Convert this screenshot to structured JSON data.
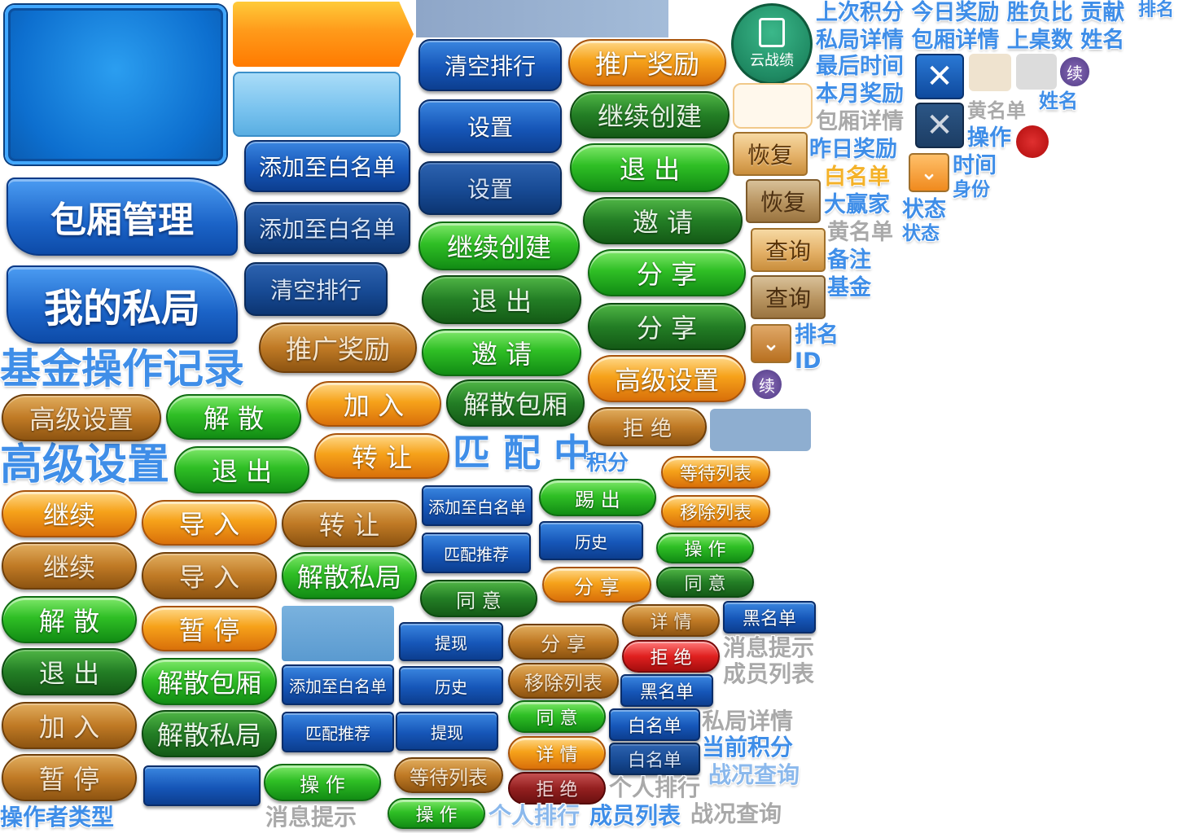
{
  "banners": {
    "room_manage": "包厢管理",
    "my_private": "我的私局"
  },
  "titles": {
    "fund_log": "基金操作记录",
    "advanced": "高级设置",
    "matching": "匹 配 中",
    "operator_type": "操作者类型"
  },
  "blue_buttons": {
    "clear_rank_1": "清空排行",
    "settings_1": "设置",
    "settings_2": "设置",
    "whitelist_add_1": "添加至白名单",
    "whitelist_add_2": "添加至白名单",
    "clear_rank_2": "清空排行",
    "whitelist_add_3": "添加至白名单",
    "match_rec_1": "匹配推荐",
    "history_1": "历史",
    "withdraw_1": "提现",
    "whitelist_add_4": "添加至白名单",
    "history_2": "历史",
    "match_rec_2": "匹配推荐",
    "withdraw_2": "提现",
    "blacklist_1": "黑名单",
    "blacklist_2": "黑名单",
    "whitelist_1": "白名单",
    "whitelist_2": "白名单"
  },
  "orange_buttons": {
    "promo_reward_1": "推广奖励",
    "promo_reward_2": "推广奖励",
    "advanced_1": "高级设置",
    "advanced_2": "高级设置",
    "join_1": "加 入",
    "transfer_1": "转 让",
    "continue_1": "继续",
    "continue_2": "继续",
    "import_1": "导 入",
    "import_2": "导 入",
    "transfer_2": "转 让",
    "pause_1": "暂 停",
    "join_2": "加 入",
    "pause_2": "暂 停",
    "reject_1": "拒 绝",
    "wait_list_1": "等待列表",
    "remove_list_1": "移除列表",
    "share_1": "分 享",
    "detail_1": "详 情",
    "share_2": "分 享",
    "remove_list_2": "移除列表",
    "detail_2": "详 情",
    "wait_list_2": "等待列表"
  },
  "green_buttons": {
    "continue_create_1": "继续创建",
    "continue_create_2": "继续创建",
    "exit_1": "退 出",
    "exit_2": "退 出",
    "invite_1": "邀 请",
    "invite_2": "邀 请",
    "share_1": "分 享",
    "share_2": "分 享",
    "dissolve_1": "解 散",
    "exit_3": "退 出",
    "dissolve_room_1": "解散包厢",
    "dissolve_private_1": "解散私局",
    "dissolve_2": "解 散",
    "exit_4": "退 出",
    "dissolve_room_2": "解散包厢",
    "dissolve_private_2": "解散私局",
    "kick": "踢 出",
    "agree_1": "同 意",
    "operate_1": "操 作",
    "agree_2": "同 意",
    "agree_3": "同 意",
    "operate_2": "操 作",
    "operate_3": "操 作"
  },
  "red_buttons": {
    "reject_2": "拒 绝",
    "reject_3": "拒 绝"
  },
  "tan_buttons": {
    "restore_1": "恢复",
    "restore_2": "恢复",
    "query_1": "查询",
    "query_2": "查询"
  },
  "badge": {
    "cloud_record": "云战绩",
    "continue_mark": "续"
  },
  "labels": {
    "top_row_1": "上次积分 今日奖励 胜负比 贡献",
    "top_rank": "排名",
    "top_row_2": "私局详情 包厢详情 上桌数 姓名",
    "last_time": "最后时间",
    "month_reward": "本月奖励",
    "room_detail_grey": "包厢详情",
    "yellow_list_grey": "黄名单",
    "name_small": "姓名",
    "operate": "操作",
    "yesterday_reward": "昨日奖励",
    "whitelist_yel": "白名单",
    "time": "时间",
    "identity": "身份",
    "big_winner": "大赢家",
    "status_1": "状态",
    "yellow_list_2": "黄名单",
    "status_2": "状态",
    "note": "备注",
    "fund": "基金",
    "rank": "排名",
    "id": "ID",
    "points": "积分",
    "msg_tip_1": "消息提示",
    "member_list_1": "成员列表",
    "private_detail": "私局详情",
    "current_points": "当前积分",
    "battle_query_1": "战况查询",
    "personal_rank_1": "个人排行",
    "msg_tip_2": "消息提示",
    "personal_rank_2": "个人排行",
    "member_list_2": "成员列表",
    "battle_query_2": "战况查询"
  },
  "colors": {
    "blue": "#1656b8",
    "green": "#2fbf25",
    "orange": "#f6a21a",
    "red": "#e0201f",
    "caption": "#3f8ee8"
  }
}
